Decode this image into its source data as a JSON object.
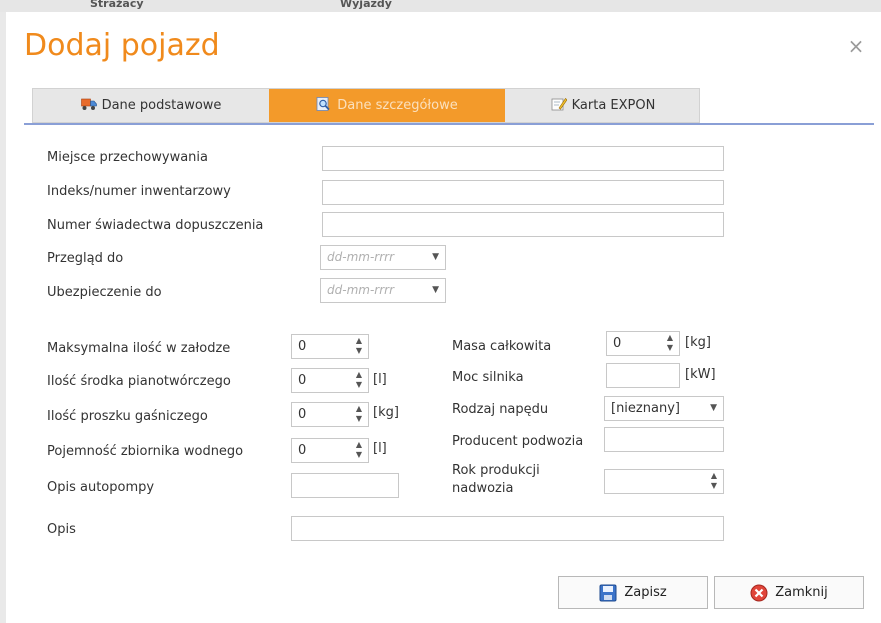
{
  "background": {
    "items": [
      "Strażacy",
      "Wyjazdy"
    ]
  },
  "dialog": {
    "title": "Dodaj pojazd",
    "close_glyph": "×",
    "accent_color": "#f39a2a"
  },
  "tabs": [
    {
      "label": "Dane podstawowe",
      "icon": "truck-icon",
      "active": false
    },
    {
      "label": "Dane szczegółowe",
      "icon": "magnifier-icon",
      "active": true
    },
    {
      "label": "Karta EXPON",
      "icon": "pencil-note-icon",
      "active": false
    }
  ],
  "form": {
    "miejsce": {
      "label": "Miejsce przechowywania",
      "value": ""
    },
    "indeks": {
      "label": "Indeks/numer inwentarzowy",
      "value": ""
    },
    "swiadectwo": {
      "label": "Numer świadectwa dopuszczenia",
      "value": ""
    },
    "przeglad": {
      "label": "Przegląd do",
      "placeholder": "dd-mm-rrrr"
    },
    "ubezpieczenie": {
      "label": "Ubezpieczenie do",
      "placeholder": "dd-mm-rrrr"
    },
    "zaloga": {
      "label": "Maksymalna ilość w załodze",
      "value": "0",
      "unit": ""
    },
    "piana": {
      "label": "Ilość środka pianotwórczego",
      "value": "0",
      "unit": "[l]"
    },
    "proszek": {
      "label": "Ilość proszku gaśniczego",
      "value": "0",
      "unit": "[kg]"
    },
    "zbiornik": {
      "label": "Pojemność zbiornika wodnego",
      "value": "0",
      "unit": "[l]"
    },
    "autopompa": {
      "label": "Opis autopompy",
      "value": ""
    },
    "masa": {
      "label": "Masa całkowita",
      "value": "0",
      "unit": "[kg]"
    },
    "moc": {
      "label": "Moc silnika",
      "value": "",
      "unit": "[kW]"
    },
    "naped": {
      "label": "Rodzaj napędu",
      "value": "[nieznany]"
    },
    "producent": {
      "label": "Producent podwozia",
      "value": ""
    },
    "rok": {
      "label": "Rok produkcji nadwozia",
      "value": ""
    },
    "opis": {
      "label": "Opis",
      "value": ""
    }
  },
  "buttons": {
    "save": "Zapisz",
    "close": "Zamknij"
  }
}
